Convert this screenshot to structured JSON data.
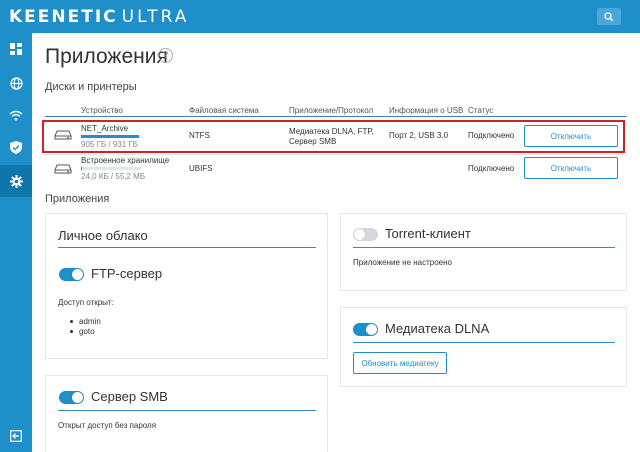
{
  "header": {
    "brand_bold": "KEENETIC",
    "brand_model": "ULTRA"
  },
  "sidebar": {
    "items": [
      {
        "icon": "dashboard-icon"
      },
      {
        "icon": "globe-icon"
      },
      {
        "icon": "wifi-icon"
      },
      {
        "icon": "shield-icon"
      },
      {
        "icon": "gear-icon",
        "active": true
      }
    ],
    "bottom_icon": "logout-icon"
  },
  "page": {
    "title": "Приложения",
    "help": "?"
  },
  "disks": {
    "section_title": "Диски и принтеры",
    "headers": [
      "Устройство",
      "Файловая система",
      "Приложение/Протокол",
      "Информация о USB",
      "Статус"
    ],
    "rows": [
      {
        "name": "NET_Archive",
        "size": "905 ГБ / 931 ГБ",
        "usage": 0.97,
        "fs": "NTFS",
        "app_line1": "Медиатека DLNA, FTP,",
        "app_line2": "Сервер SMB",
        "usb": "Порт 2, USB 3.0",
        "status": "Подключено",
        "button": "Отключить"
      },
      {
        "name": "Встроенное хранилище",
        "size": "24,0 КБ / 55,2 МБ",
        "usage": 0.01,
        "fs": "UBIFS",
        "app_line1": "",
        "app_line2": "",
        "usb": "",
        "status": "Подключено",
        "button": "Отключить"
      }
    ]
  },
  "apps": {
    "section_title": "Приложения",
    "personal_cloud": {
      "title": "Личное облако",
      "ftp_label": "FTP-сервер",
      "ftp_enabled": true,
      "access_label": "Доступ открыт:",
      "users": [
        "admin",
        "goto"
      ]
    },
    "smb": {
      "label": "Сервер SMB",
      "enabled": true,
      "desc": "Открыт доступ без пароля"
    },
    "torrent": {
      "label": "Torrent-клиент",
      "enabled": false,
      "desc": "Приложение не настроено"
    },
    "dlna": {
      "label": "Медиатека DLNA",
      "enabled": true,
      "button": "Обновить медиатеку"
    }
  },
  "colors": {
    "brand": "#1f8fc9",
    "highlight": "#d0202a"
  }
}
